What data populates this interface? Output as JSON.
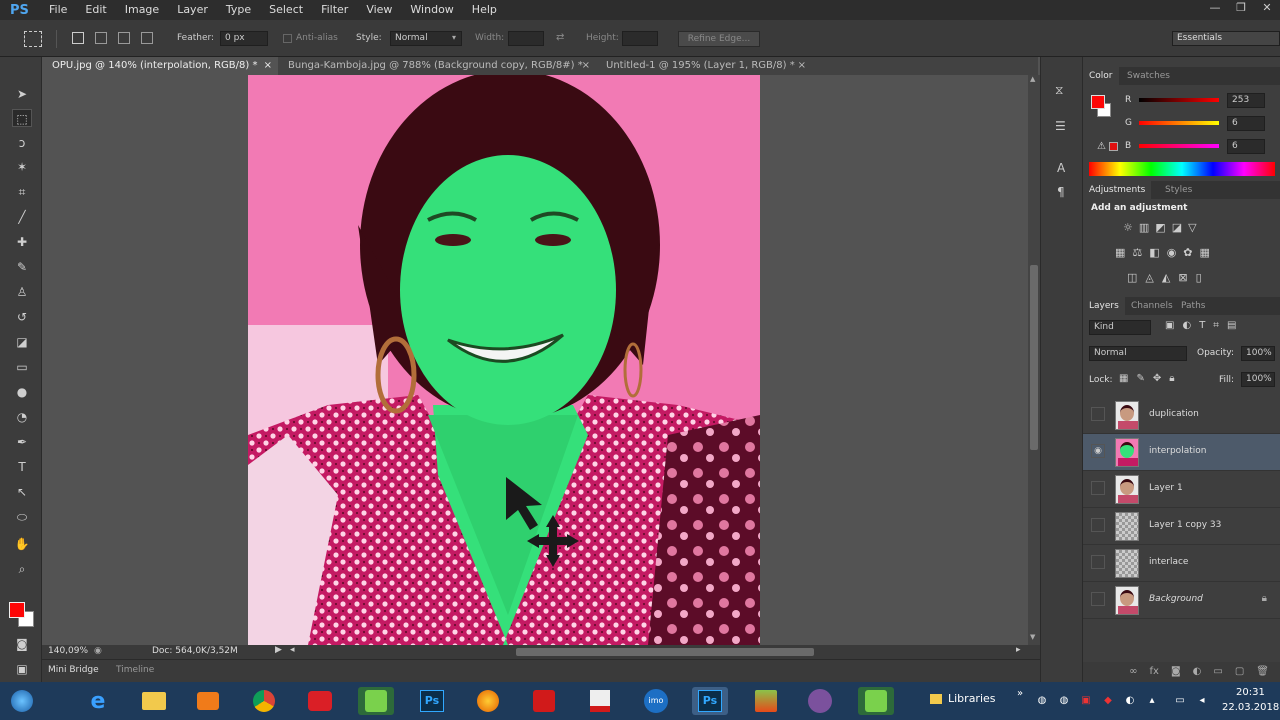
{
  "menu": {
    "logo": "PS",
    "items": [
      "File",
      "Edit",
      "Image",
      "Layer",
      "Type",
      "Select",
      "Filter",
      "View",
      "Window",
      "Help"
    ]
  },
  "window_controls": {
    "minimize": "—",
    "restore": "❐",
    "close": "✕"
  },
  "options": {
    "feather_label": "Feather:",
    "feather_value": "0 px",
    "antialias_label": "Anti-alias",
    "style_label": "Style:",
    "style_value": "Normal",
    "width_label": "Width:",
    "height_label": "Height:",
    "refine_edge": "Refine Edge...",
    "workspace": "Essentials"
  },
  "tabs": [
    {
      "label": "OPU.jpg @ 140% (interpolation, RGB/8) *",
      "close": "×"
    },
    {
      "label": "Bunga-Kamboja.jpg @ 788% (Background copy, RGB/8#) *",
      "close": "×"
    },
    {
      "label": "Untitled-1 @ 195% (Layer 1, RGB/8) *",
      "close": "×"
    }
  ],
  "status": {
    "zoom": "140,09%",
    "doc": "Doc: 564,0K/3,52M"
  },
  "bottom_tabs": {
    "mini_bridge": "Mini Bridge",
    "timeline": "Timeline"
  },
  "color_panel": {
    "tab_color": "Color",
    "tab_swatches": "Swatches",
    "r_label": "R",
    "g_label": "G",
    "b_label": "B",
    "r_value": "253",
    "g_value": "6",
    "b_value": "6",
    "foreground": "#fd0606"
  },
  "adjustments_panel": {
    "tab_adjustments": "Adjustments",
    "tab_styles": "Styles",
    "heading": "Add an adjustment"
  },
  "layers_panel": {
    "tab_layers": "Layers",
    "tab_channels": "Channels",
    "tab_paths": "Paths",
    "kind": "Kind",
    "blend_mode": "Normal",
    "opacity_label": "Opacity:",
    "opacity_value": "100%",
    "lock_label": "Lock:",
    "fill_label": "Fill:",
    "fill_value": "100%",
    "layers": [
      {
        "name": "duplication",
        "visible": false,
        "selected": false,
        "thumb": "photo"
      },
      {
        "name": "interpolation",
        "visible": true,
        "selected": true,
        "thumb": "green"
      },
      {
        "name": "Layer 1",
        "visible": false,
        "selected": false,
        "thumb": "photo"
      },
      {
        "name": "Layer 1 copy 33",
        "visible": false,
        "selected": false,
        "thumb": "transparent"
      },
      {
        "name": "interlace",
        "visible": false,
        "selected": false,
        "thumb": "transparent"
      },
      {
        "name": "Background",
        "visible": false,
        "selected": false,
        "thumb": "photo"
      }
    ]
  },
  "taskbar": {
    "libraries": "Libraries",
    "time": "20:31",
    "date": "22.03.2018"
  },
  "colors": {
    "accent_blue": "#4fa6f0",
    "photo_bg": "#f27ab4",
    "skin_green": "#35e07a",
    "hair": "#3a0a12",
    "dress": "#c0206a"
  }
}
